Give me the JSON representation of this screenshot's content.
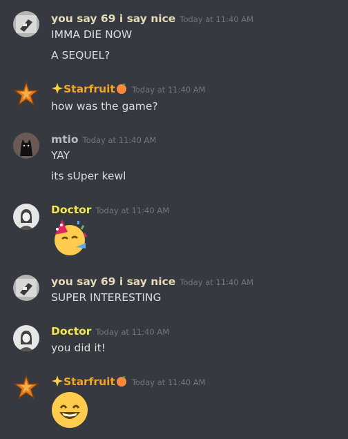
{
  "messages": [
    {
      "author": "you say 69 i say nice",
      "author_color": "#e7dcb8",
      "timestamp": "Today at 11:40 AM",
      "avatar": "ghost-phone-avatar",
      "lines": [
        "IMMA DIE NOW",
        "A SEQUEL?"
      ]
    },
    {
      "author": "Starfruit",
      "author_color": "#f5a623",
      "author_prefix_icon": "sparkle-star-icon",
      "author_suffix_icon": "peach-icon",
      "timestamp": "Today at 11:40 AM",
      "avatar": "starfruit-avatar",
      "lines": [
        "how was the game?"
      ]
    },
    {
      "author": "mtio",
      "author_color": "#b9bbbe",
      "timestamp": "Today at 11:40 AM",
      "avatar": "black-cat-avatar",
      "lines": [
        "YAY",
        "its sUper kewl"
      ]
    },
    {
      "author": "Doctor",
      "author_color": "#f5e94a",
      "timestamp": "Today at 11:40 AM",
      "avatar": "doctor-portrait-avatar",
      "emoji": "partying-face-emoji"
    },
    {
      "author": "you say 69 i say nice",
      "author_color": "#e7dcb8",
      "timestamp": "Today at 11:40 AM",
      "avatar": "ghost-phone-avatar",
      "lines": [
        "SUPER INTERESTING"
      ]
    },
    {
      "author": "Doctor",
      "author_color": "#f5e94a",
      "timestamp": "Today at 11:40 AM",
      "avatar": "doctor-portrait-avatar",
      "lines": [
        "you did it!"
      ]
    },
    {
      "author": "Starfruit",
      "author_color": "#f5a623",
      "author_prefix_icon": "sparkle-star-icon",
      "author_suffix_icon": "peach-icon",
      "timestamp": "Today at 11:40 AM",
      "avatar": "starfruit-avatar",
      "emoji": "grinning-face-emoji"
    }
  ]
}
